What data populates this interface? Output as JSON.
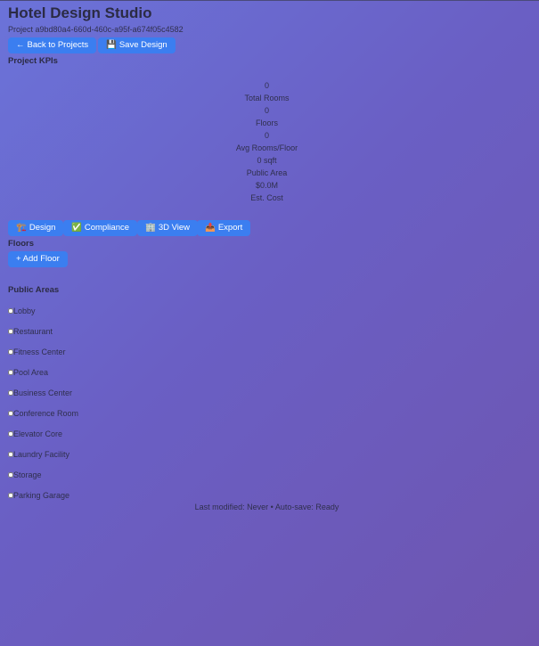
{
  "header": {
    "title": "Hotel Design Studio",
    "project_id": "Project a9bd80a4-660d-460c-a95f-a674f05c4582"
  },
  "toolbar": {
    "back": {
      "icon": "←",
      "label": "Back to Projects"
    },
    "save": {
      "icon": "💾",
      "label": "Save Design"
    }
  },
  "kpis": {
    "section_title": "Project KPIs",
    "items": [
      {
        "value": "0",
        "label": "Total Rooms"
      },
      {
        "value": "0",
        "label": "Floors"
      },
      {
        "value": "0",
        "label": "Avg Rooms/Floor"
      },
      {
        "value": "0 sqft",
        "label": "Public Area"
      },
      {
        "value": "$0.0M",
        "label": "Est. Cost"
      }
    ]
  },
  "tabs": [
    {
      "icon": "🏗️",
      "label": "Design"
    },
    {
      "icon": "✅",
      "label": "Compliance"
    },
    {
      "icon": "🏢",
      "label": "3D View"
    },
    {
      "icon": "📤",
      "label": "Export"
    }
  ],
  "floors": {
    "section_title": "Floors",
    "add_button": "+ Add Floor"
  },
  "public_areas": {
    "section_title": "Public Areas",
    "items": [
      {
        "label": "Lobby",
        "checked": false
      },
      {
        "label": "Restaurant",
        "checked": false
      },
      {
        "label": "Fitness Center",
        "checked": false
      },
      {
        "label": "Pool Area",
        "checked": false
      },
      {
        "label": "Business Center",
        "checked": false
      },
      {
        "label": "Conference Room",
        "checked": false
      },
      {
        "label": "Elevator Core",
        "checked": false
      },
      {
        "label": "Laundry Facility",
        "checked": false
      },
      {
        "label": "Storage",
        "checked": false
      },
      {
        "label": "Parking Garage",
        "checked": false
      }
    ]
  },
  "footer": {
    "status": "Last modified: Never • Auto-save: Ready"
  },
  "colors": {
    "button": "#3b7ef0",
    "background_start": "#6b73d9",
    "background_end": "#6e55b0"
  }
}
